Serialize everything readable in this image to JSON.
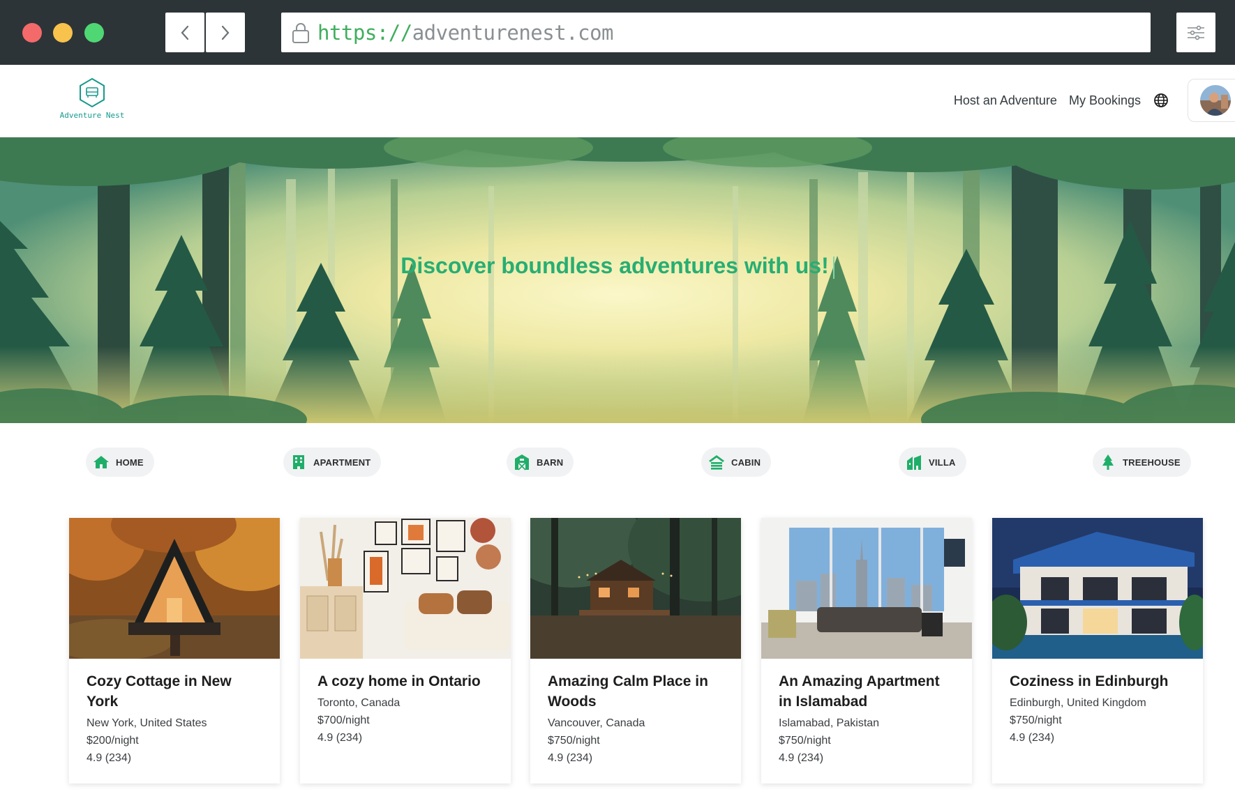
{
  "browser": {
    "url_scheme": "https://",
    "url_host": "adventurenest.com"
  },
  "site": {
    "logo_text": "Adventure Nest",
    "nav": {
      "host": "Host an Adventure",
      "bookings": "My Bookings"
    }
  },
  "hero": {
    "title": "Discover boundless adventures with us!"
  },
  "categories": [
    {
      "label": "HOME",
      "icon": "home-icon"
    },
    {
      "label": "APARTMENT",
      "icon": "building-icon"
    },
    {
      "label": "BARN",
      "icon": "barn-icon"
    },
    {
      "label": "CABIN",
      "icon": "cabin-icon"
    },
    {
      "label": "VILLA",
      "icon": "villa-icon"
    },
    {
      "label": "TREEHOUSE",
      "icon": "tree-icon"
    }
  ],
  "listings": [
    {
      "title": "Cozy Cottage in New York",
      "location": "New York, United States",
      "price": "$200/night",
      "rating": "4.9 (234)"
    },
    {
      "title": "A cozy home in Ontario",
      "location": "Toronto, Canada",
      "price": "$700/night",
      "rating": "4.9 (234)"
    },
    {
      "title": "Amazing Calm Place in Woods",
      "location": "Vancouver, Canada",
      "price": "$750/night",
      "rating": "4.9 (234)"
    },
    {
      "title": "An Amazing Apartment in Islamabad",
      "location": "Islamabad, Pakistan",
      "price": "$750/night",
      "rating": "4.9 (234)"
    },
    {
      "title": "Coziness in Edinburgh",
      "location": "Edinburgh, United Kingdom",
      "price": "$750/night",
      "rating": "4.9 (234)"
    }
  ],
  "colors": {
    "accent": "#27ae73",
    "icon_green": "#1fae69",
    "logo_teal": "#169a8c",
    "chrome": "#2d3438"
  }
}
